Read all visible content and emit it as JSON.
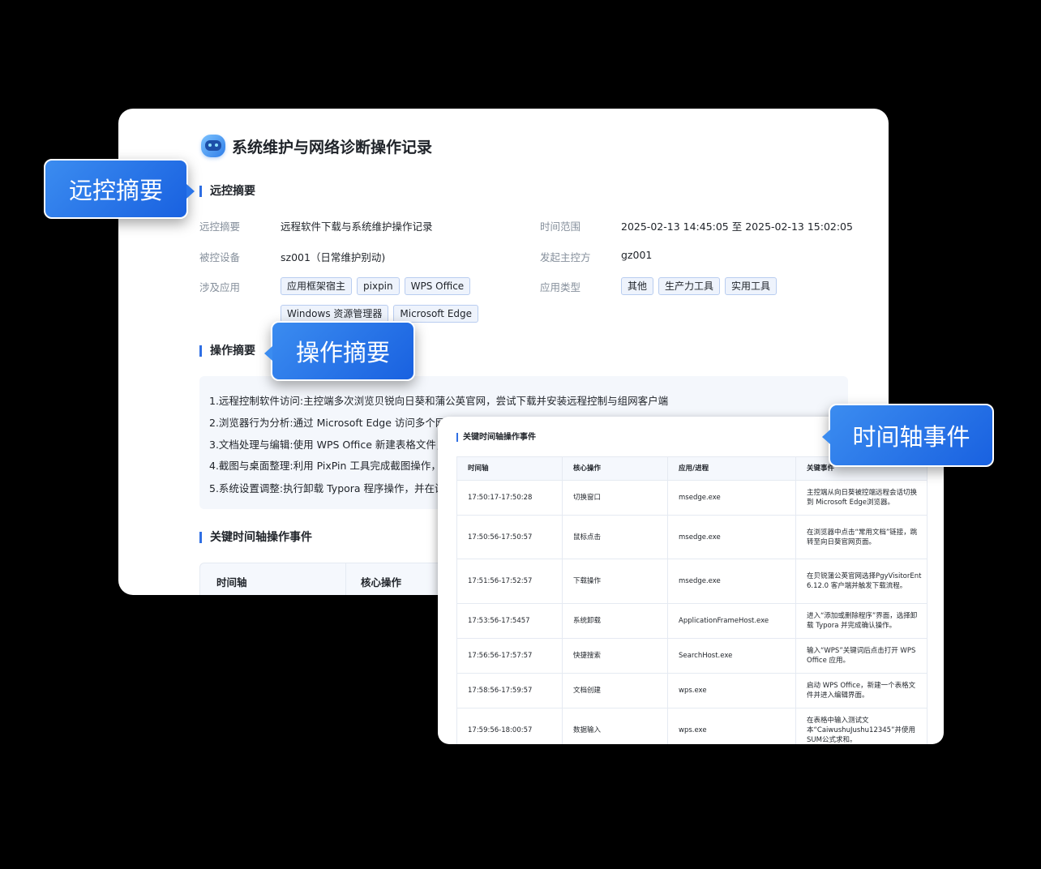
{
  "report": {
    "title": "系统维护与网络诊断操作记录",
    "section_summary": "远控摘要",
    "fields": {
      "summary_label": "远控摘要",
      "summary_value": "远程软件下载与系统维护操作记录",
      "time_label": "时间范围",
      "time_value": "2025-02-13 14:45:05 至 2025-02-13 15:02:05",
      "device_label": "被控设备",
      "device_value": "sz001（日常维护别动)",
      "initiator_label": "发起主控方",
      "initiator_value": "gz001",
      "apps_label": "涉及应用",
      "apps": [
        "应用框架宿主",
        "pixpin",
        "WPS Office",
        "Windows 资源管理器",
        "Microsoft Edge"
      ],
      "app_types_label": "应用类型",
      "app_types": [
        "其他",
        "生产力工具",
        "实用工具"
      ]
    },
    "section_ops": "操作摘要",
    "ops": [
      "1.远程控制软件访问:主控端多次浏览贝锐向日葵和蒲公英官网，尝试下载并安装远程控制与组网客户端",
      "2.浏览器行为分析:通过 Microsoft Edge 访问多个网页",
      "3.文档处理与编辑:使用 WPS Office 新建表格文件，",
      "4.截图与桌面整理:利用 PixPin 工具完成截图操作，并",
      "5.系统设置调整:执行卸载 Typora 程序操作，并在设置"
    ],
    "section_timeline": "关键时间轴操作事件",
    "table_headers": [
      "时间轴",
      "核心操作"
    ]
  },
  "callouts": {
    "summary": "远控摘要",
    "ops": "操作摘要",
    "timeline": "时间轴事件"
  },
  "timeline_card": {
    "title": "关键时间轴操作事件",
    "headers": [
      "时间轴",
      "核心操作",
      "应用/进程",
      "关键事件"
    ],
    "rows": [
      {
        "time": "17:50:17-17:50:28",
        "op": "切换窗口",
        "proc": "msedge.exe",
        "event": "主控端从向日葵被控端远程会话切换到 Microsoft Edge浏览器。"
      },
      {
        "time": "17:50:56-17:50:57",
        "op": "鼠标点击",
        "proc": "msedge.exe",
        "event": "在浏览器中点击“常用文档”链接，跳转至向日葵官网页面。"
      },
      {
        "time": "17:51:56-17:52:57",
        "op": "下载操作",
        "proc": "msedge.exe",
        "event": "在贝锐蒲公英官网选择PgyVisitorEnt 6.12.0 客户端并触发下载流程。"
      },
      {
        "time": "17:53:56-17:5457",
        "op": "系统卸载",
        "proc": "ApplicationFrameHost.exe",
        "event": "进入“添加或删除程序”界面，选择卸载 Typora 并完成确认操作。"
      },
      {
        "time": "17:56:56-17:57:57",
        "op": "快捷搜索",
        "proc": "SearchHost.exe",
        "event": "输入“WPS”关键词后点击打开 WPS Office 应用。"
      },
      {
        "time": "17:58:56-17:59:57",
        "op": "文档创建",
        "proc": "wps.exe",
        "event": "启动 WPS Office，新建一个表格文件并进入编辑界面。"
      },
      {
        "time": "17:59:56-18:00:57",
        "op": "数据输入",
        "proc": "wps.exe",
        "event": "在表格中输入测试文本“CaiwushuJushu12345”并使用 SUM公式求和。"
      }
    ]
  }
}
